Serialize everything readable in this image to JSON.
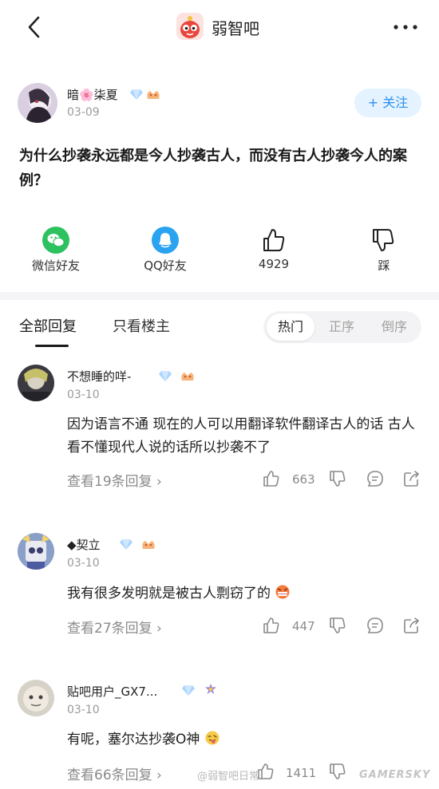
{
  "header": {
    "forum_name": "弱智吧",
    "back_icon": "chevron-left-icon",
    "more_icon": "more-dots-icon"
  },
  "post": {
    "author": "暗🌸柒夏",
    "date": "03-09",
    "follow_label": "+ 关注",
    "title": "为什么抄袭永远都是今人抄袭古人，而没有古人抄袭今人的案例？"
  },
  "share": {
    "wechat": "微信好友",
    "qq": "QQ好友",
    "likes": "4929",
    "dislike": "踩"
  },
  "tabs": {
    "all": "全部回复",
    "op_only": "只看楼主",
    "sort_hot": "热门",
    "sort_asc": "正序",
    "sort_desc": "倒序"
  },
  "comments": [
    {
      "name": "不想睡的咩-",
      "date": "03-10",
      "text": "因为语言不通 现在的人可以用翻译软件翻译古人的话 古人看不懂现代人说的话所以抄袭不了",
      "replies": "查看19条回复",
      "likes": "663"
    },
    {
      "name": "◆契立",
      "date": "03-10",
      "text": "我有很多发明就是被古人剽窃了的",
      "replies": "查看27条回复",
      "likes": "447"
    },
    {
      "name": "贴吧用户_GX7...",
      "date": "03-10",
      "text": "有呢，塞尔达抄袭O神",
      "replies": "查看66条回复",
      "likes": "1411"
    }
  ],
  "watermark": {
    "weibo": "@弱智吧日常",
    "site": "GAMERSKY"
  },
  "colors": {
    "accent": "#2d8ff0",
    "follow_bg": "#e4f3ff",
    "wechat": "#2dc15f",
    "qq": "#2aa3f0",
    "gray_text": "#9a9a9a"
  }
}
